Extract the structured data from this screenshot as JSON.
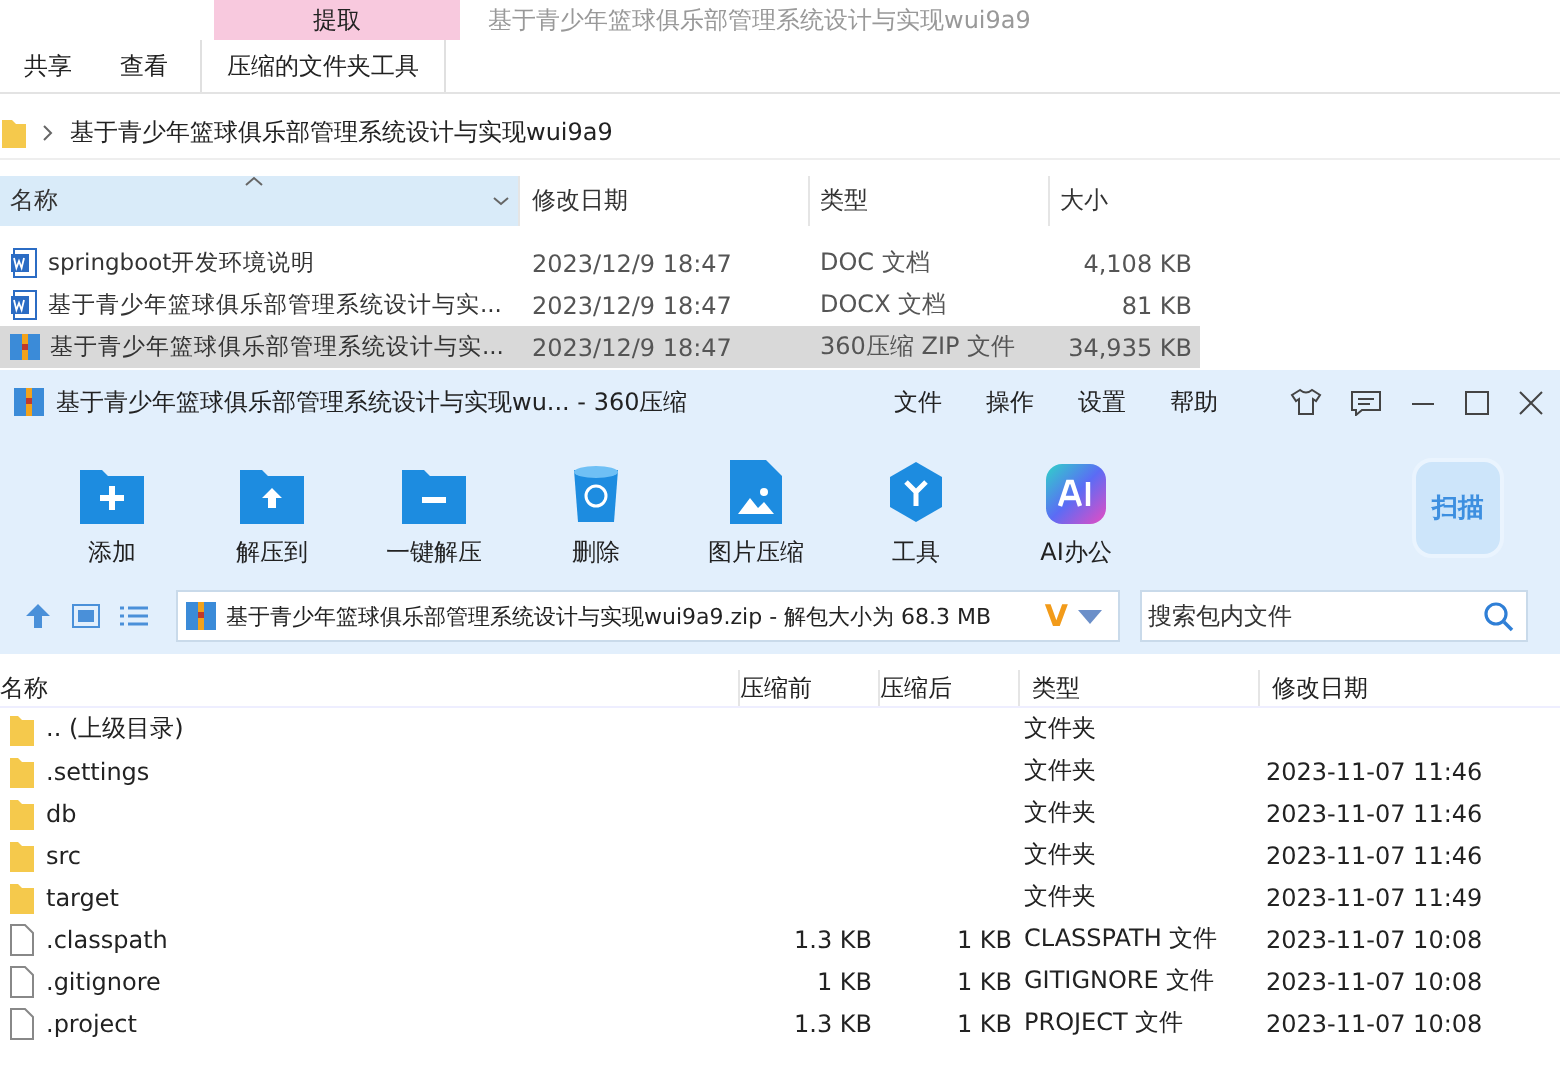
{
  "explorer": {
    "context_group": "提取",
    "window_title": "基于青少年篮球俱乐部管理系统设计与实现wui9a9",
    "ribbon_tabs": [
      {
        "label": "共享",
        "kind": "plain",
        "selected": false
      },
      {
        "label": "查看",
        "kind": "plain",
        "selected": false
      },
      {
        "label": "压缩的文件夹工具",
        "kind": "context",
        "selected": false
      }
    ],
    "breadcrumb": "基于青少年篮球俱乐部管理系统设计与实现wui9a9",
    "columns": [
      {
        "label": "名称",
        "selected": true
      },
      {
        "label": "修改日期",
        "selected": false
      },
      {
        "label": "类型",
        "selected": false
      },
      {
        "label": "大小",
        "selected": false
      }
    ],
    "files": [
      {
        "name": "springboot开发环境说明",
        "date": "2023/12/9 18:47",
        "type": "DOC 文档",
        "size": "4,108 KB",
        "kind": "doc",
        "selected": false
      },
      {
        "name": "基于青少年篮球俱乐部管理系统设计与实...",
        "date": "2023/12/9 18:47",
        "type": "DOCX 文档",
        "size": "81 KB",
        "kind": "doc",
        "selected": false
      },
      {
        "name": "基于青少年篮球俱乐部管理系统设计与实...",
        "date": "2023/12/9 18:47",
        "type": "360压缩 ZIP 文件",
        "size": "34,935 KB",
        "kind": "zip",
        "selected": true
      }
    ]
  },
  "zip_app": {
    "title": "基于青少年篮球俱乐部管理系统设计与实现wu... - 360压缩",
    "menu": [
      "文件",
      "操作",
      "设置",
      "帮助"
    ],
    "toolbar": [
      {
        "label": "添加",
        "kind": "add"
      },
      {
        "label": "解压到",
        "kind": "extract"
      },
      {
        "label": "一键解压",
        "kind": "oneclick"
      },
      {
        "label": "删除",
        "kind": "delete"
      },
      {
        "label": "图片压缩",
        "kind": "image"
      },
      {
        "label": "工具",
        "kind": "tools"
      },
      {
        "label": "AI办公",
        "kind": "ai"
      }
    ],
    "scan_button": "扫描",
    "path": "基于青少年篮球俱乐部管理系统设计与实现wui9a9.zip - 解包大小为 68.3 MB",
    "path_badge": "V",
    "search": {
      "placeholder": "搜索包内文件"
    },
    "columns": [
      "名称",
      "压缩前",
      "压缩后",
      "类型",
      "修改日期"
    ],
    "rows": [
      {
        "name": ".. (上级目录)",
        "kind": "folder",
        "before": "",
        "after": "",
        "type": "文件夹",
        "date": ""
      },
      {
        "name": ".settings",
        "kind": "folder",
        "before": "",
        "after": "",
        "type": "文件夹",
        "date": "2023-11-07 11:46"
      },
      {
        "name": "db",
        "kind": "folder",
        "before": "",
        "after": "",
        "type": "文件夹",
        "date": "2023-11-07 11:46"
      },
      {
        "name": "src",
        "kind": "folder",
        "before": "",
        "after": "",
        "type": "文件夹",
        "date": "2023-11-07 11:46"
      },
      {
        "name": "target",
        "kind": "folder",
        "before": "",
        "after": "",
        "type": "文件夹",
        "date": "2023-11-07 11:49"
      },
      {
        "name": ".classpath",
        "kind": "file",
        "before": "1.3 KB",
        "after": "1 KB",
        "type": "CLASSPATH 文件",
        "date": "2023-11-07 10:08"
      },
      {
        "name": ".gitignore",
        "kind": "file",
        "before": "1 KB",
        "after": "1 KB",
        "type": "GITIGNORE 文件",
        "date": "2023-11-07 10:08"
      },
      {
        "name": ".project",
        "kind": "file",
        "before": "1.3 KB",
        "after": "1 KB",
        "type": "PROJECT 文件",
        "date": "2023-11-07 10:08"
      }
    ]
  }
}
